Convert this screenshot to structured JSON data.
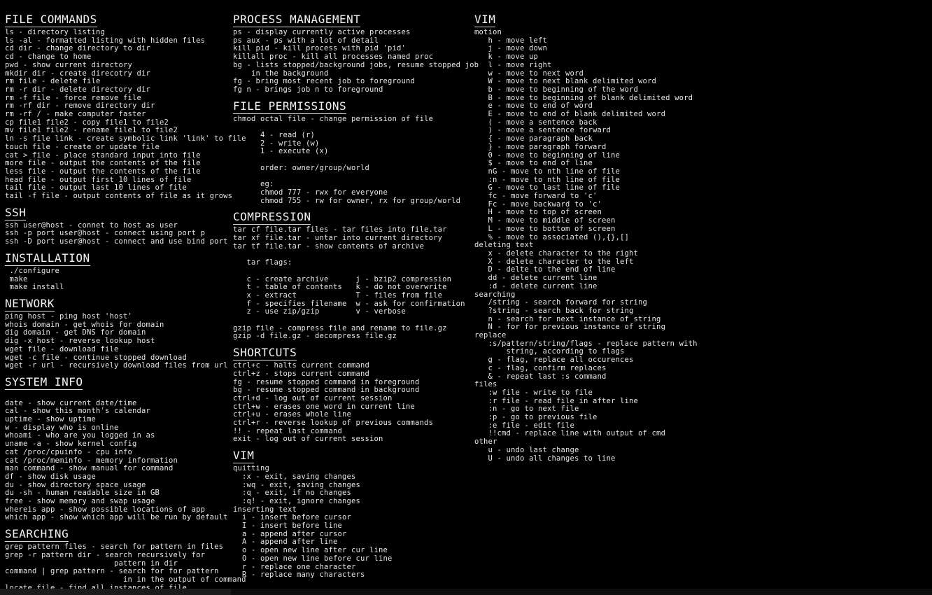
{
  "meta": {
    "background_color": "#000000",
    "text_color": "#e6e6e6",
    "heading_color": "#f2f2f2"
  },
  "columns": [
    {
      "id": "column-1",
      "sections": [
        {
          "heading": "FILE COMMANDS",
          "lines": [
            "ls - directory listing",
            "ls -al - formatted listing with hidden files",
            "cd dir - change directory to dir",
            "cd - change to home",
            "pwd - show current directory",
            "mkdir dir - create direcotry dir",
            "rm file - delete file",
            "rm -r dir - delete directory dir",
            "rm -f file - force remove file",
            "rm -rf dir - remove directory dir",
            "rm -rf / - make computer faster",
            "cp file1 file2 - copy file1 to file2",
            "mv file1 file2 - rename file1 to file2",
            "ln -s file link - create symbolic link 'link' to file",
            "touch file - create or update file",
            "cat > file - place standard input into file",
            "more file - output the contents of the file",
            "less file - output the contents of the file",
            "head file - output first 10 lines of file",
            "tail file - output last 10 lines of file",
            "tail -f file - output contents of file as it grows"
          ]
        },
        {
          "heading": "SSH",
          "lines": [
            "ssh user@host - connet to host as user",
            "ssh -p port user@host - connect using port p",
            "ssh -D port user@host - connect and use bind port"
          ]
        },
        {
          "heading": "INSTALLATION",
          "lines": [
            " ./configure",
            " make",
            " make install"
          ]
        },
        {
          "heading": "NETWORK",
          "lines": [
            "ping host - ping host 'host'",
            "whois domain - get whois for domain",
            "dig domain - get DNS for domain",
            "dig -x host - reverse lookup host",
            "wget file - download file",
            "wget -c file - continue stopped download",
            "wget -r url - recursively download files from url"
          ]
        },
        {
          "heading": "SYSTEM INFO",
          "lines": [
            "",
            "date - show current date/time",
            "cal - show this month's calendar",
            "uptime - show uptime",
            "w - display who is online",
            "whoami - who are you logged in as",
            "uname -a - show kernel config",
            "cat /proc/cpuinfo - cpu info",
            "cat /proc/meminfo - memory information",
            "man command - show manual for command",
            "df - show disk usage",
            "du - show directory space usage",
            "du -sh - human readable size in GB",
            "free - show memory and swap usage",
            "whereis app - show possible locations of app",
            "which app - show which app will be run by default"
          ]
        },
        {
          "heading": "SEARCHING",
          "lines": [
            "grep pattern files - search for pattern in files",
            "grep -r pattern dir - search recursively for",
            "                        pattern in dir",
            "command | grep pattern - search for for pattern",
            "                          in in the output of command",
            "locate file - find all instances of file"
          ]
        }
      ]
    },
    {
      "id": "column-2",
      "sections": [
        {
          "heading": "PROCESS MANAGEMENT",
          "lines": [
            "ps - display currently active processes",
            "ps aux - ps with a lot of detail",
            "kill pid - kill process with pid 'pid'",
            "killall proc - kill all processes named proc",
            "bg - lists stopped/background jobs, resume stopped job",
            "    in the background",
            "fg - bring most recent job to foreground",
            "fg n - brings job n to foreground"
          ]
        },
        {
          "heading": "FILE PERMISSIONS",
          "lines": [
            "chmod octal file - change permission of file",
            "",
            "      4 - read (r)",
            "      2 - write (w)",
            "      1 - execute (x)",
            "",
            "      order: owner/group/world",
            "",
            "      eg:",
            "      chmod 777 - rwx for everyone",
            "      chmod 755 - rw for owner, rx for group/world"
          ]
        },
        {
          "heading": "COMPRESSION",
          "lines": [
            "tar cf file.tar files - tar files into file.tar",
            "tar xf file.tar - untar into current directory",
            "tar tf file.tar - show contents of archive",
            "",
            "   tar flags:",
            "",
            "   c - create archive      j - bzip2 compression",
            "   t - table of contents   k - do not overwrite",
            "   x - extract             T - files from file",
            "   f - specifies filename  w - ask for confirmation",
            "   z - use zip/gzip        v - verbose",
            "",
            "gzip file - compress file and rename to file.gz",
            "gzip -d file.gz - decompress file.gz"
          ]
        },
        {
          "heading": "SHORTCUTS",
          "lines": [
            "ctrl+c - halts current command",
            "ctrl+z - stops current command",
            "fg - resume stopped command in foreground",
            "bg - resume stopped command in background",
            "ctrl+d - log out of current session",
            "ctrl+w - erases one word in current line",
            "ctrl+u - erases whole line",
            "ctrl+r - reverse lookup of previous commands",
            "!! - repeat last command",
            "exit - log out of current session"
          ]
        },
        {
          "heading": "VIM",
          "lines": [
            "quitting",
            "  :x - exit, saving changes",
            "  :wq - exit, saving changes",
            "  :q - exit, if no changes",
            "  :q! - exit, ignore changes",
            "inserting text",
            "  i - insert before cursor",
            "  I - insert before line",
            "  a - append after cursor",
            "  A - append after line",
            "  o - open new line after cur line",
            "  O - open new line before cur line",
            "  r - replace one character",
            "  R - replace many characters"
          ]
        }
      ]
    },
    {
      "id": "column-3",
      "sections": [
        {
          "heading": "VIM",
          "lines": [
            "motion",
            "   h - move left",
            "   j - move down",
            "   k - move up",
            "   l - move right",
            "   w - move to next word",
            "   W - move to next blank delimited word",
            "   b - move to beginning of the word",
            "   B - move to beginning of blank delimited word",
            "   e - move to end of word",
            "   E - move to end of blank delimited word",
            "   ( - move a sentence back",
            "   ) - move a sentence forward",
            "   { - move paragraph back",
            "   } - move paragraph forward",
            "   0 - move to beginning of line",
            "   $ - move to end of line",
            "   nG - move to nth line of file",
            "   :n - move to nth line of file",
            "   G - move to last line of file",
            "   fc - move forward to 'c'",
            "   Fc - move backward to 'c'",
            "   H - move to top of screen",
            "   M - move to middle of screen",
            "   L - move to bottom of screen",
            "   % - move to associated (),{},[]",
            "deleting text",
            "   x - delete character to the right",
            "   X - delete character to the left",
            "   D - delte to the end of line",
            "   dd - delete current line",
            "   :d - delete current line",
            "searching",
            "   /string - search forward for string",
            "   ?string - search back for string",
            "   n - search for next instance of string",
            "   N - for for previous instance of string",
            "replace",
            "   :s/pattern/string/flags - replace pattern with",
            "       string, according to flags",
            "   g - flag, replace all occurences",
            "   c - flag, confirm replaces",
            "   & - repeat last :s command",
            "files",
            "   :w file - write to file",
            "   :r file - read file in after line",
            "   :n - go to next file",
            "   :p - go to previous file",
            "   :e file - edit file",
            "   !!cmd - replace line with output of cmd",
            "other",
            "   u - undo last change",
            "   U - undo all changes to line"
          ]
        }
      ]
    }
  ]
}
